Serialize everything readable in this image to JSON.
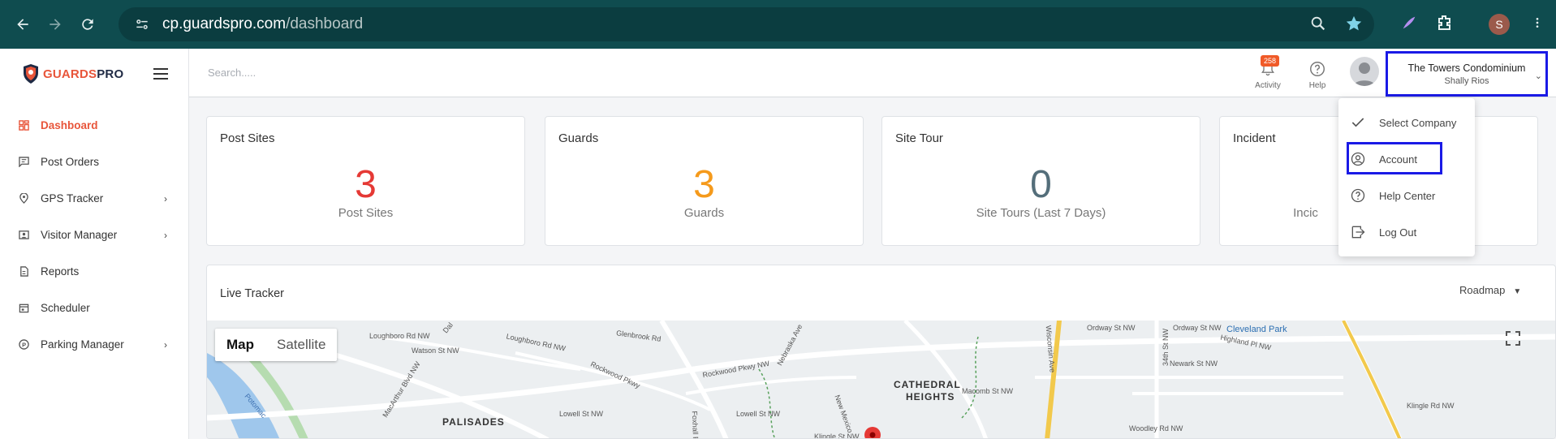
{
  "browser": {
    "url_domain": "cp.guardspro.com",
    "url_path": "/dashboard",
    "profile_initial": "S"
  },
  "sidebar": {
    "brand_part1": "GUARDS",
    "brand_part2": "PRO",
    "items": [
      {
        "label": "Dashboard",
        "icon": "grid-icon",
        "active": true
      },
      {
        "label": "Post Orders",
        "icon": "message-icon"
      },
      {
        "label": "GPS Tracker",
        "icon": "location-pin-icon",
        "chevron": "›"
      },
      {
        "label": "Visitor Manager",
        "icon": "id-card-icon",
        "chevron": "›"
      },
      {
        "label": "Reports",
        "icon": "document-icon"
      },
      {
        "label": "Scheduler",
        "icon": "calendar-icon"
      },
      {
        "label": "Parking Manager",
        "icon": "parking-icon",
        "chevron": "›"
      }
    ]
  },
  "header": {
    "search_placeholder": "Search.....",
    "activity_badge": "258",
    "activity_label": "Activity",
    "help_label": "Help",
    "company_name": "The Towers Condominium",
    "user_name": "Shally Rios"
  },
  "cards": [
    {
      "title": "Post Sites",
      "value": "3",
      "subtitle": "Post Sites",
      "color": "#e53935"
    },
    {
      "title": "Guards",
      "value": "3",
      "subtitle": "Guards",
      "color": "#f59a1b"
    },
    {
      "title": "Site Tour",
      "value": "0",
      "subtitle": "Site Tours (Last 7 Days)",
      "color": "#546e7a"
    },
    {
      "title": "Incident",
      "value": "",
      "subtitle": "Incic",
      "color": "#546e7a"
    }
  ],
  "tracker": {
    "title": "Live Tracker",
    "map_type": "Roadmap",
    "map_tab": "Map",
    "satellite_tab": "Satellite",
    "labels": {
      "palisades": "PALISADES",
      "cathedral1": "CATHEDRAL",
      "cathedral2": "HEIGHTS",
      "cleveland": "Cleveland Park",
      "loughboro1": "Loughboro Rd NW",
      "loughboro2": "Loughboro Rd NW",
      "glenbrook": "Glenbrook Rd",
      "watson": "Watson St NW",
      "nebraska": "Nebraska Ave",
      "rockwood": "Rockwood Pkwy NW",
      "rockwood2": "Rockwood Pkwy",
      "macarthur": "MacArthur Blvd NW",
      "lowell1": "Lowell St NW",
      "lowell2": "Lowell St NW",
      "macomb": "Macomb St NW",
      "ordway1": "Ordway St NW",
      "ordway2": "Ordway St NW",
      "newark": "Newark St NW",
      "highland": "Highland Pl NW",
      "kingle": "Klingle St NW",
      "kingle2": "Klingle Rd NW",
      "woodley": "Woodley Rd NW",
      "wisconsin": "Wisconsin Ave",
      "potomac": "Potomac",
      "foxhall": "Foxhall Rd",
      "newmex": "New Mexico",
      "34th": "34th St NW",
      "dal": "Dal"
    }
  },
  "dropdown": {
    "items": [
      {
        "label": "Select Company",
        "icon": "check-icon"
      },
      {
        "label": "Account",
        "icon": "account-circle-icon"
      },
      {
        "label": "Help Center",
        "icon": "help-circle-icon"
      },
      {
        "label": "Log Out",
        "icon": "logout-icon"
      }
    ]
  }
}
